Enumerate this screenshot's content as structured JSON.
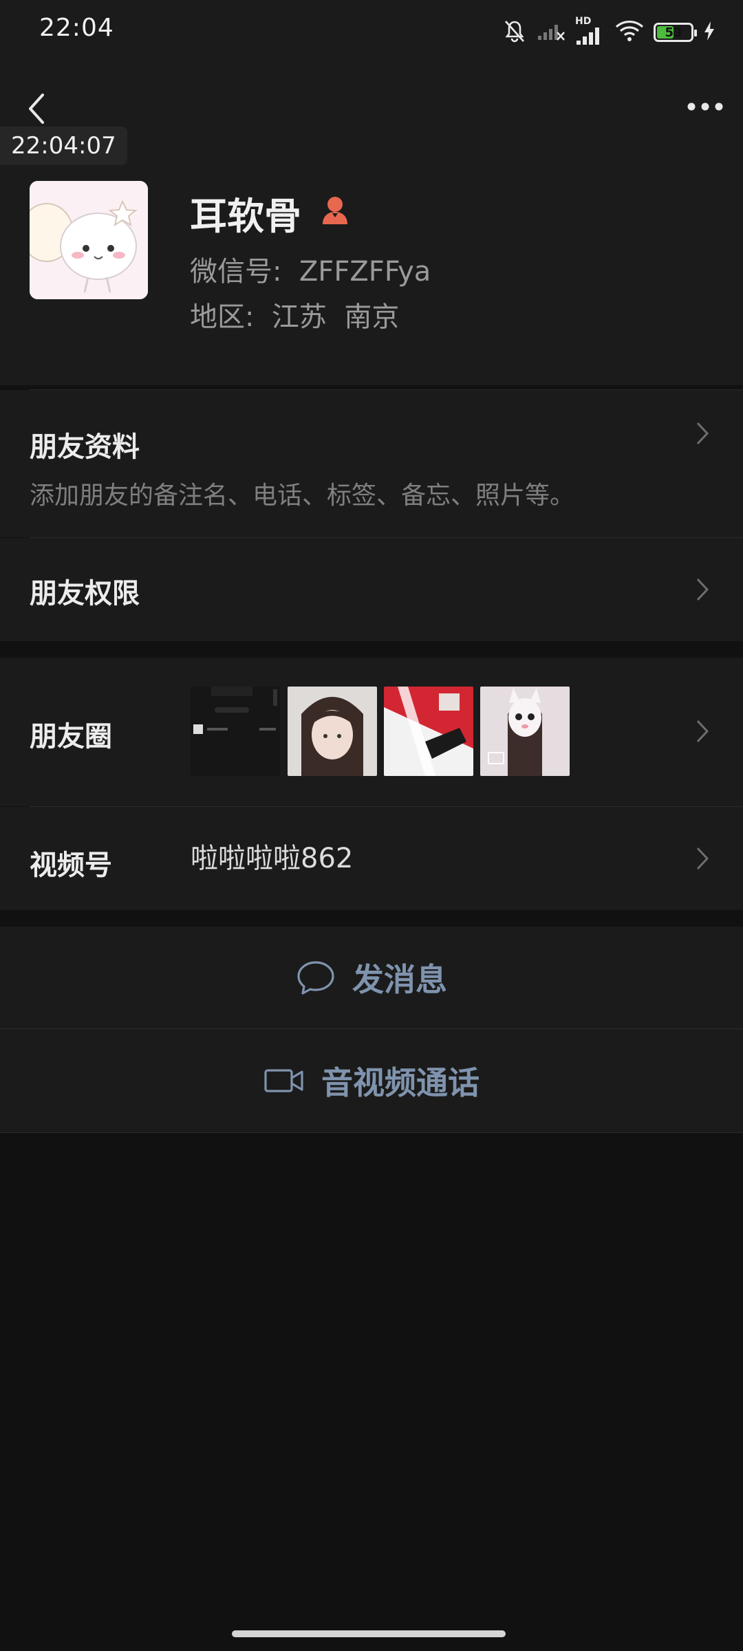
{
  "status_bar": {
    "time": "22:04",
    "battery": "53",
    "battery_level": 0.53,
    "network_label": "HD",
    "icons": [
      "mute-bell-icon",
      "signal-off-icon",
      "signal-hd-icon",
      "wifi-icon",
      "battery-icon",
      "charging-icon"
    ]
  },
  "overlay_time": "22:04:07",
  "profile": {
    "nickname": "耳软骨",
    "wechat_id": "微信号:  ZFFZFFya",
    "region": "地区:  江苏  南京",
    "gender_icon": "female-badge-icon"
  },
  "rows": {
    "friend_info": {
      "title": "朋友资料",
      "subtitle": "添加朋友的备注名、电话、标签、备忘、照片等。"
    },
    "permissions": {
      "title": "朋友权限"
    },
    "moments": {
      "title": "朋友圈"
    },
    "channels": {
      "title": "视频号",
      "value": "啦啦啦啦862"
    }
  },
  "actions": {
    "message": "发消息",
    "call": "音视频通话"
  },
  "colors": {
    "background": "#111111",
    "panel": "#1b1b1b",
    "action_text": "#7f93ad",
    "badge": "#e8674f"
  }
}
